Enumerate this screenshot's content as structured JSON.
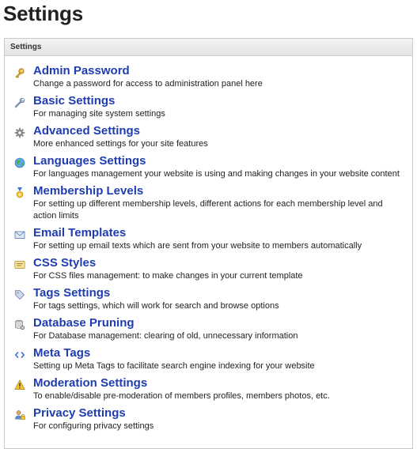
{
  "page": {
    "title": "Settings"
  },
  "panel": {
    "header": "Settings"
  },
  "items": [
    {
      "icon": "key-icon",
      "title": "Admin Password",
      "description": "Change a password for access to administration panel here"
    },
    {
      "icon": "wrench-icon",
      "title": "Basic Settings",
      "description": "For managing site system settings"
    },
    {
      "icon": "gear-icon",
      "title": "Advanced Settings",
      "description": "More enhanced settings for your site features"
    },
    {
      "icon": "globe-icon",
      "title": "Languages Settings",
      "description": "For languages management your website is using and making changes in your website content"
    },
    {
      "icon": "medal-icon",
      "title": "Membership Levels",
      "description": "For setting up different membership levels, different actions for each membership level and action limits"
    },
    {
      "icon": "envelope-icon",
      "title": "Email Templates",
      "description": "For setting up email texts which are sent from your website to members automatically"
    },
    {
      "icon": "css-icon",
      "title": "CSS Styles",
      "description": "For CSS files management: to make changes in your current template"
    },
    {
      "icon": "tag-icon",
      "title": "Tags Settings",
      "description": "For tags settings, which will work for search and browse options"
    },
    {
      "icon": "database-icon",
      "title": "Database Pruning",
      "description": "For Database management: clearing of old, unnecessary information"
    },
    {
      "icon": "code-icon",
      "title": "Meta Tags",
      "description": "Setting up Meta Tags to facilitate search engine indexing for your website"
    },
    {
      "icon": "warning-icon",
      "title": "Moderation Settings",
      "description": "To enable/disable pre-moderation of members profiles, members photos, etc."
    },
    {
      "icon": "privacy-icon",
      "title": "Privacy Settings",
      "description": "For configuring privacy settings"
    }
  ]
}
